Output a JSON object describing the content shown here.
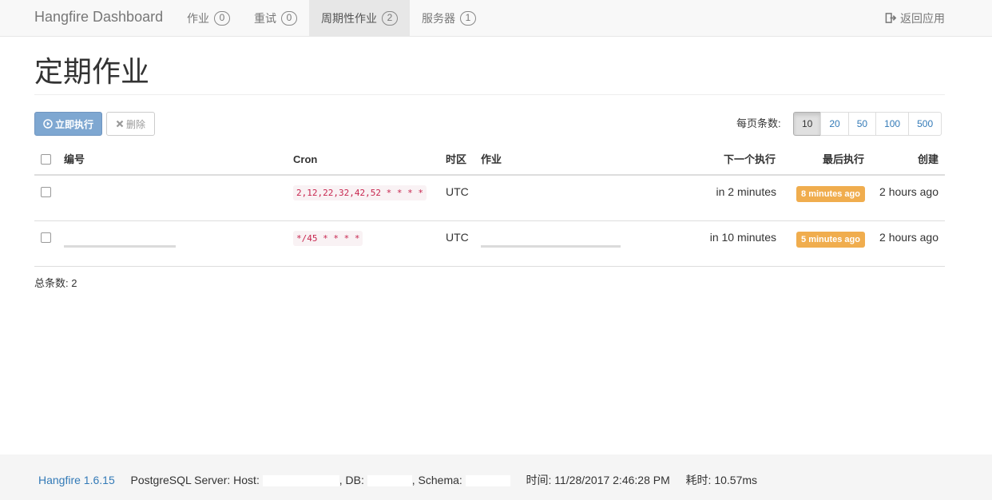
{
  "navbar": {
    "brand": "Hangfire Dashboard",
    "items": [
      {
        "label": "作业",
        "count": "0"
      },
      {
        "label": "重试",
        "count": "0"
      },
      {
        "label": "周期性作业",
        "count": "2"
      },
      {
        "label": "服务器",
        "count": "1"
      }
    ],
    "active_index": 2,
    "back_label": "返回应用"
  },
  "page": {
    "title": "定期作业"
  },
  "toolbar": {
    "trigger_label": "立即执行",
    "delete_label": "删除",
    "per_page_label": "每页条数:",
    "page_sizes": [
      "10",
      "20",
      "50",
      "100",
      "500"
    ],
    "selected_page_size": "10"
  },
  "table": {
    "headers": {
      "id": "编号",
      "cron": "Cron",
      "timezone": "时区",
      "job": "作业",
      "next": "下一个执行",
      "last": "最后执行",
      "created": "创建"
    },
    "rows": [
      {
        "cron": "2,12,22,32,42,52 * * * *",
        "timezone": "UTC",
        "next": "in 2 minutes",
        "last": "8 minutes ago",
        "created": "2 hours ago"
      },
      {
        "cron": "*/45 * * * *",
        "timezone": "UTC",
        "next": "in 10 minutes",
        "last": "5 minutes ago",
        "created": "2 hours ago"
      }
    ]
  },
  "summary": {
    "total": "总条数: 2"
  },
  "footer": {
    "version": "Hangfire 1.6.15",
    "storage_prefix": "PostgreSQL Server: Host:",
    "db_label": ", DB:",
    "schema_label": ", Schema:",
    "time": "时间: 11/28/2017 2:46:28 PM",
    "elapsed": "耗时: 10.57ms"
  },
  "colors": {
    "primary": "#7ea7d1",
    "warning": "#f0ad4e",
    "link": "#337ab7",
    "code": "#c7254e"
  }
}
